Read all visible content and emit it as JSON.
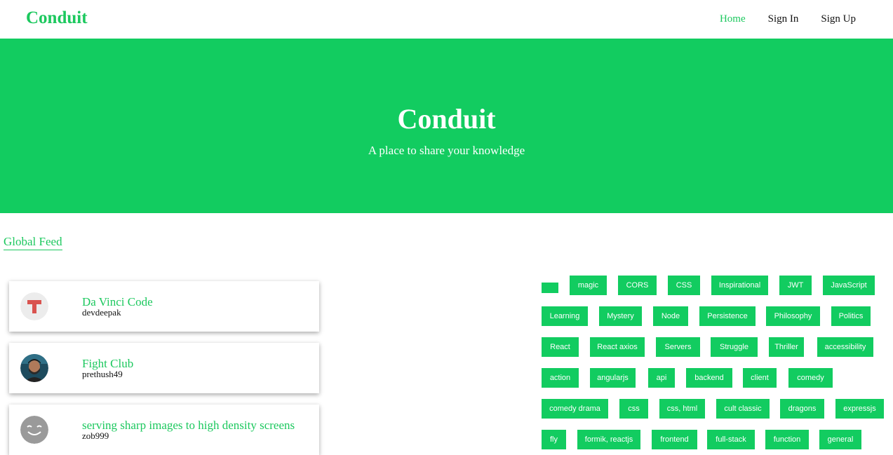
{
  "navbar": {
    "brand": "Conduit",
    "links": [
      "Home",
      "Sign In",
      "Sign Up"
    ]
  },
  "banner": {
    "title": "Conduit",
    "subtitle": "A place to share your knowledge"
  },
  "feed": {
    "tab_label": "Global Feed"
  },
  "articles": [
    {
      "title": "Da Vinci Code",
      "author": "devdeepak",
      "avatar": "letter-t-avatar"
    },
    {
      "title": "Fight Club",
      "author": "prethush49",
      "avatar": "user-photo-avatar"
    },
    {
      "title": "serving sharp images to high density screens",
      "author": "zob999",
      "avatar": "smiley-avatar"
    }
  ],
  "tags": [
    "",
    "magic",
    "CORS",
    "CSS",
    "Inspirational",
    "JWT",
    "JavaScript",
    "Learning",
    "Mystery",
    "Node",
    "Persistence",
    "Philosophy",
    "Politics",
    "React",
    "React axios",
    "Servers",
    "Struggle",
    "Thriller",
    "accessibility",
    "action",
    "angularjs",
    "api",
    "backend",
    "client",
    "comedy",
    "comedy drama",
    "css",
    "css, html",
    "cult classic",
    "dragons",
    "expressjs",
    "fly",
    "formik, reactjs",
    "frontend",
    "full-stack",
    "function",
    "general"
  ],
  "colors": {
    "accent": "#1cc85e",
    "banner": "#12cc60"
  }
}
